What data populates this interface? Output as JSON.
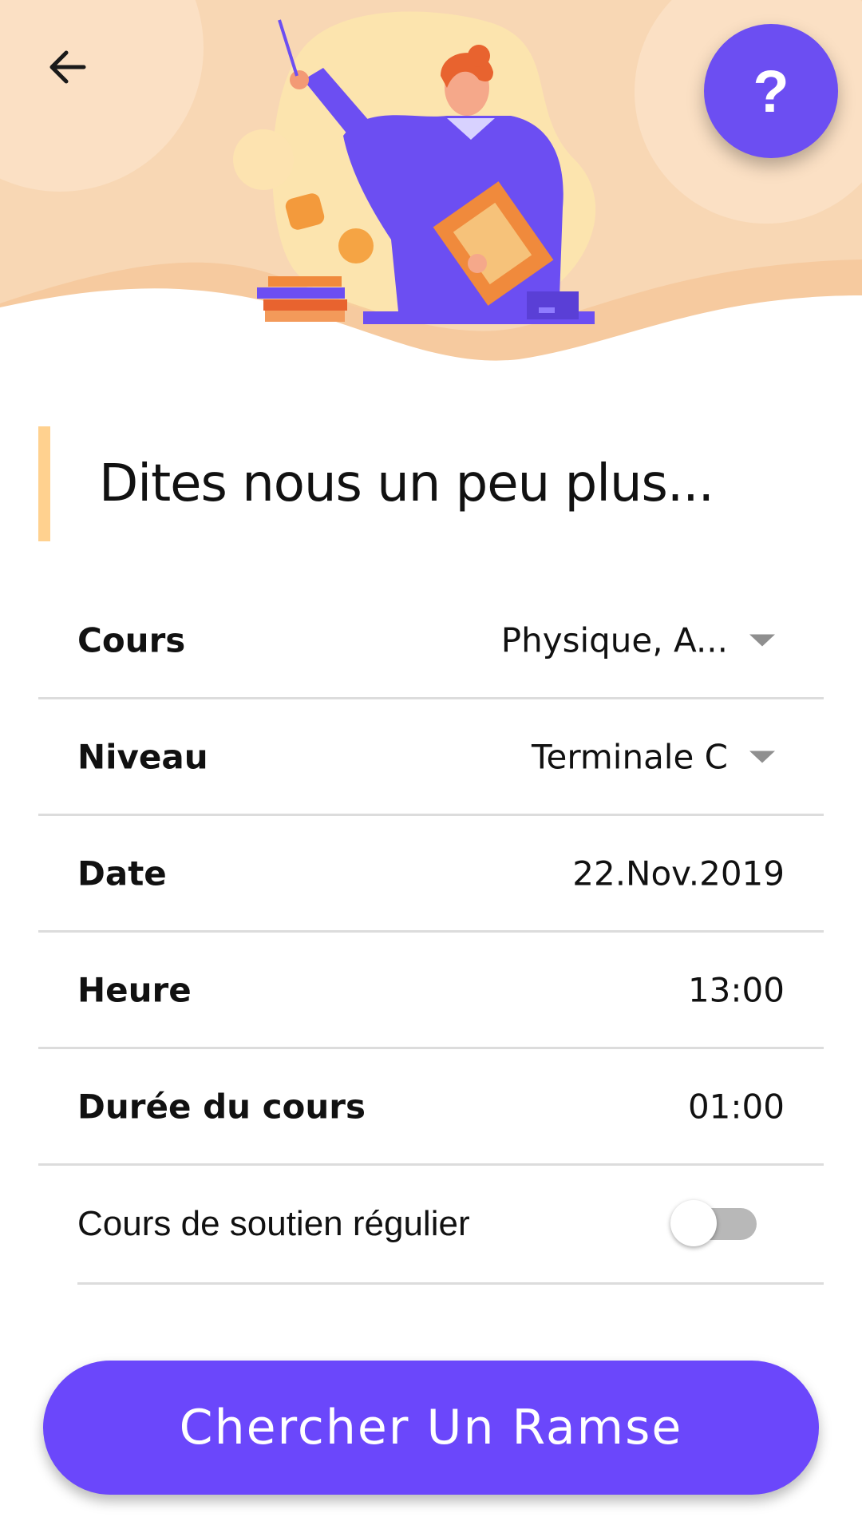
{
  "header": {
    "back_icon": "arrow-left-icon",
    "help_label": "?",
    "colors": {
      "background": "#f8d7b4",
      "accent_purple": "#6c4ef2"
    }
  },
  "heading": {
    "title": "Dites nous un peu plus..."
  },
  "form": {
    "rows": [
      {
        "label": "Cours",
        "value": "Physique, A..."
      },
      {
        "label": "Niveau",
        "value": "Terminale C"
      },
      {
        "label": "Date",
        "value": "22.Nov.2019"
      },
      {
        "label": "Heure",
        "value": "13:00"
      },
      {
        "label": "Durée du cours",
        "value": "01:00"
      }
    ],
    "toggle": {
      "label": "Cours de soutien régulier",
      "checked": false
    }
  },
  "actions": {
    "primary_label": "Chercher Un Ramse",
    "primary_color": "#6b47fb"
  }
}
